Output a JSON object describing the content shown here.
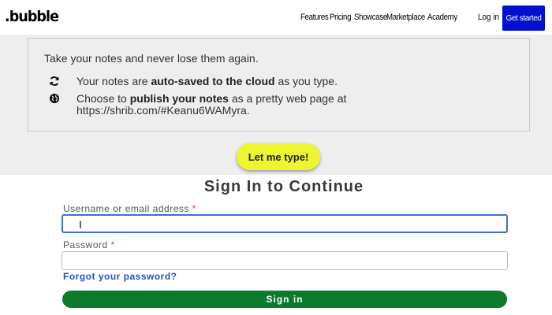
{
  "nav": {
    "logo": ".bubble",
    "links": [
      "Features",
      "Pricing",
      "Showcase",
      "Marketplace",
      "Academy"
    ],
    "login": "Log in",
    "get_started": "Get started"
  },
  "info": {
    "title": "Take your notes and never lose them again.",
    "rows": [
      {
        "icon": "refresh-icon",
        "pre": "Your notes are ",
        "bold": "auto-saved to the cloud",
        "post": " as you type."
      },
      {
        "icon": "globe-icon",
        "pre": "Choose to ",
        "bold": "publish your notes",
        "post": " as a pretty web page at https://shrib.com/#Keanu6WAMyra."
      }
    ]
  },
  "type_button": "Let me type!",
  "signin": {
    "title": "Sign In to Continue",
    "username_label": "Username or email address",
    "username_value": "I",
    "password_label": "Password",
    "required_mark": "*",
    "forgot": "Forgot your password?",
    "submit": "Sign in"
  },
  "colors": {
    "get_started_bg": "#0010d0",
    "type_button_bg": "#ecf52f",
    "signin_button_bg": "#0b7a2a",
    "link": "#2450c8"
  }
}
